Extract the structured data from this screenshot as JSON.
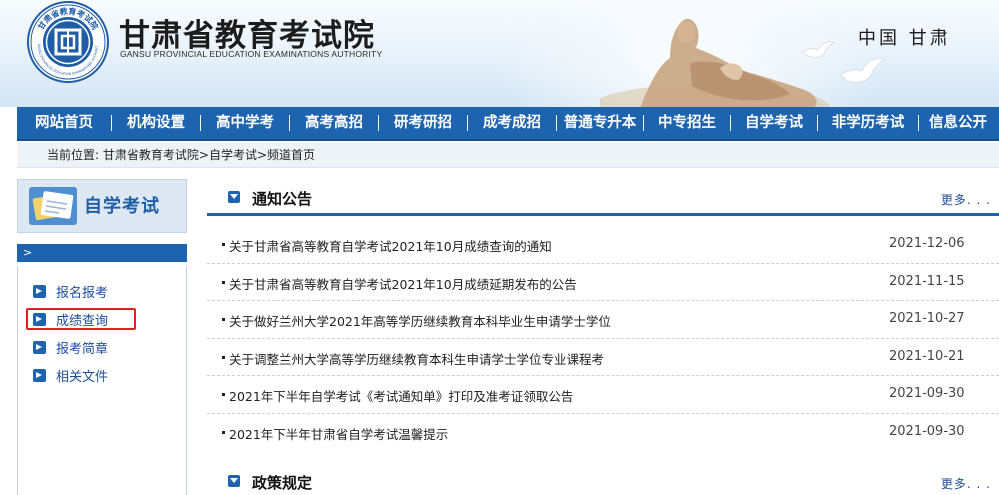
{
  "header": {
    "title": "甘肃省教育考试院",
    "subtitle_en": "GANSU PROVINCIAL EDUCATION EXAMINATIONS AUTHORITY",
    "slogan": "中国 甘肃",
    "logo_text": "甘肃省教育考试院",
    "logo_text_en": "GANSU PROVINCIAL EDUCATION EXAMINATIONS AUTHORITY"
  },
  "nav": {
    "items": [
      {
        "label": "网站首页"
      },
      {
        "label": "机构设置"
      },
      {
        "label": "高中学考"
      },
      {
        "label": "高考高招"
      },
      {
        "label": "研考研招"
      },
      {
        "label": "成考成招"
      },
      {
        "label": "普通专升本"
      },
      {
        "label": "中专招生"
      },
      {
        "label": "自学考试"
      },
      {
        "label": "非学历考试"
      },
      {
        "label": "信息公开"
      }
    ]
  },
  "breadcrumb": {
    "prefix": "当前位置: ",
    "items": [
      "甘肃省教育考试院",
      "自学考试",
      "频道首页"
    ],
    "separator": ">"
  },
  "sidebar": {
    "title": "自学考试",
    "bar_text": ">",
    "links": [
      {
        "label": "报名报考"
      },
      {
        "label": "成绩查询",
        "highlighted": true
      },
      {
        "label": "报考简章"
      },
      {
        "label": "相关文件"
      }
    ]
  },
  "sections": [
    {
      "title": "通知公告",
      "more": "更多. . .",
      "items": [
        {
          "title": "关于甘肃省高等教育自学考试2021年10月成绩查询的通知",
          "date": "2021-12-06"
        },
        {
          "title": "关于甘肃省高等教育自学考试2021年10月成绩延期发布的公告",
          "date": "2021-11-15"
        },
        {
          "title": "关于做好兰州大学2021年高等学历继续教育本科毕业生申请学士学位",
          "date": "2021-10-27"
        },
        {
          "title": "关于调整兰州大学高等学历继续教育本科生申请学士学位专业课程考",
          "date": "2021-10-21"
        },
        {
          "title": "2021年下半年自学考试《考试通知单》打印及准考证领取公告",
          "date": "2021-09-30"
        },
        {
          "title": "2021年下半年甘肃省自学考试温馨提示",
          "date": "2021-09-30"
        }
      ]
    },
    {
      "title": "政策规定",
      "more": "更多. . ."
    }
  ],
  "colors": {
    "nav_blue": "#1d63ad",
    "link_blue": "#1e4f96",
    "highlight_red": "#e0201e"
  },
  "icons": [
    "emblem-logo",
    "sidebar-exam-icon",
    "arrow-right-icon",
    "section-chevron-icon",
    "dove-icon"
  ]
}
